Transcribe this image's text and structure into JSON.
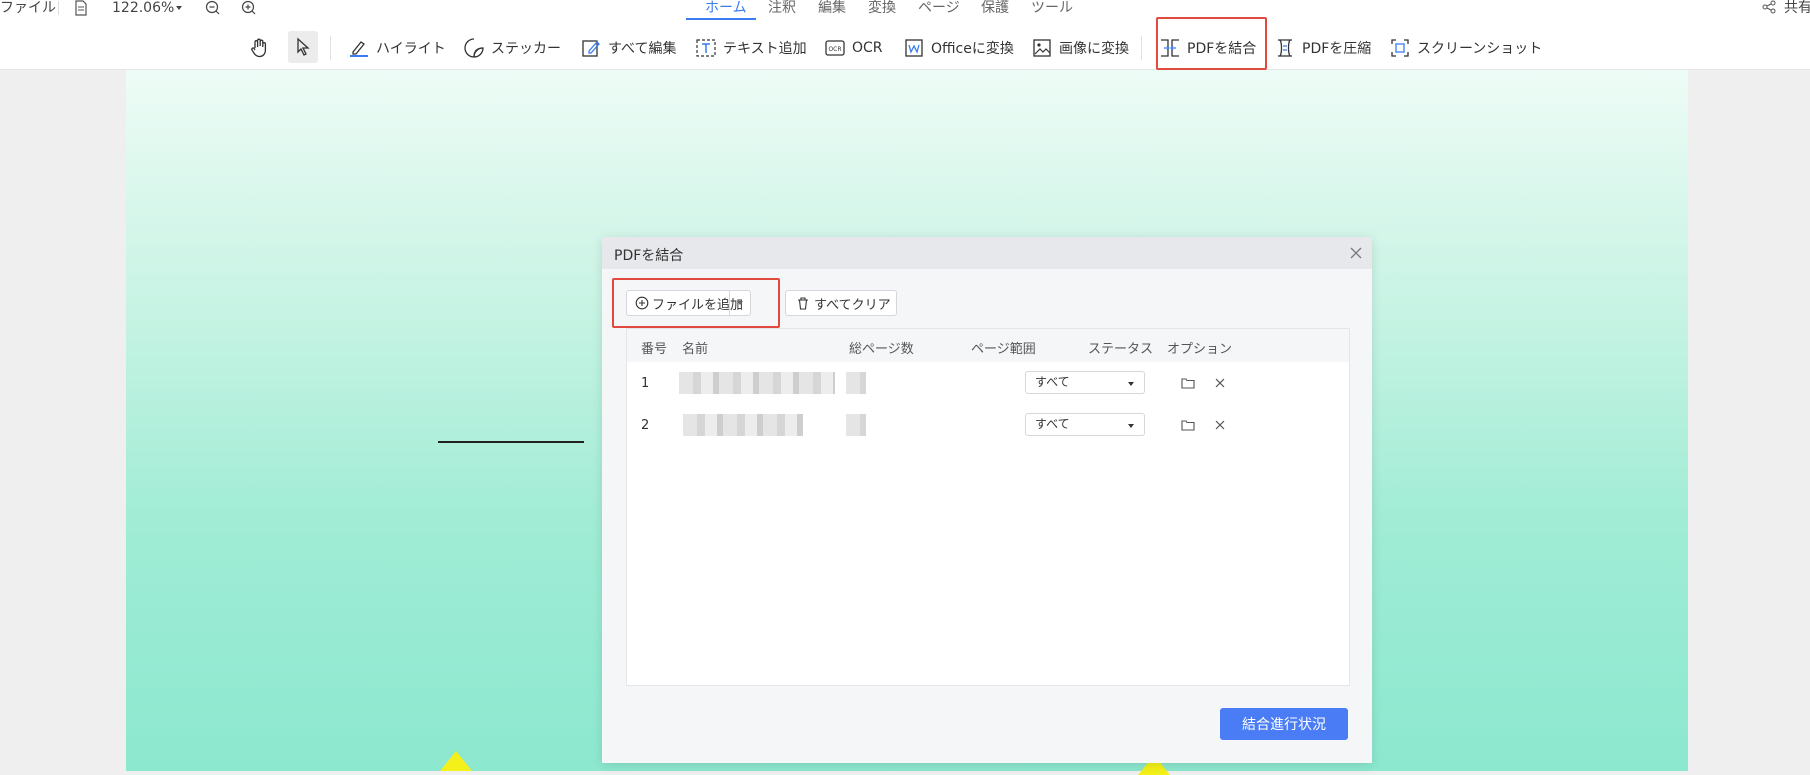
{
  "toolbar_top": {
    "file_menu": "ファイル",
    "zoom": "122.06%",
    "share": "共有"
  },
  "tabs": [
    "ホーム",
    "注釈",
    "編集",
    "変換",
    "ページ",
    "保護",
    "ツール"
  ],
  "active_tab": "ホーム",
  "tools": {
    "highlight": "ハイライト",
    "sticker": "ステッカー",
    "edit_all": "すべて編集",
    "add_text": "テキスト追加",
    "ocr": "OCR",
    "to_office": "Officeに変換",
    "to_image": "画像に変換",
    "merge_pdf": "PDFを結合",
    "compress_pdf": "PDFを圧縮",
    "screenshot": "スクリーンショット"
  },
  "dialog": {
    "title": "PDFを結合",
    "add_file": "ファイルを追加",
    "clear_all": "すべてクリア",
    "columns": {
      "number": "番号",
      "name": "名前",
      "total_pages": "総ページ数",
      "page_range": "ページ範囲",
      "status": "ステータス",
      "options": "オプション"
    },
    "rows": [
      {
        "number": "1",
        "page_range": "すべて"
      },
      {
        "number": "2",
        "page_range": "すべて"
      }
    ],
    "merge_button": "結合進行状況"
  },
  "colors": {
    "accent": "#3a7bf0",
    "primary_button": "#4a7cf6",
    "highlight_box": "#e04a3f"
  }
}
